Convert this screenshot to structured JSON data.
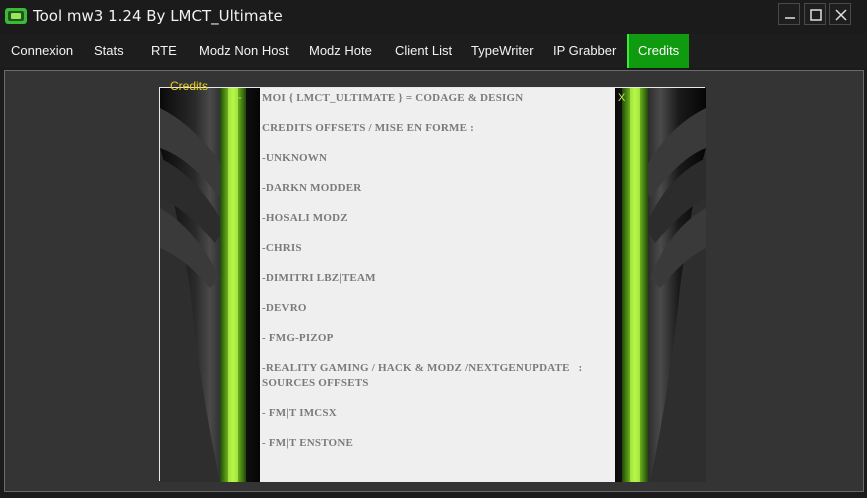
{
  "window": {
    "title": "Tool mw3 1.24 By LMCT_Ultimate",
    "icon": "app-logo-icon",
    "controls": [
      "minimize-icon",
      "maximize-icon",
      "close-icon"
    ]
  },
  "menu": {
    "tabs": [
      {
        "label": "Connexion",
        "active": false
      },
      {
        "label": "Stats",
        "active": false
      },
      {
        "label": "RTE",
        "active": false
      },
      {
        "label": "Modz Non Host",
        "active": false
      },
      {
        "label": "Modz Hote",
        "active": false
      },
      {
        "label": "Client List",
        "active": false
      },
      {
        "label": "TypeWriter",
        "active": false
      },
      {
        "label": "IP Grabber",
        "active": false
      },
      {
        "label": "Credits",
        "active": true
      }
    ]
  },
  "credits": {
    "group_label": "Credits",
    "art_controls": {
      "minimize": "-",
      "close": "X"
    },
    "lines": [
      "Moi { LMCT_Ultimate } = Codage & Design",
      "",
      "Credits Offsets / Mise en forme :",
      "",
      "-Unknown",
      "",
      "-DarkN Modder",
      "",
      "-Hosali Modz",
      "",
      "-Chris",
      "",
      "-Dimitri LBZ|Team",
      "",
      "-Devro",
      "",
      "- FMG-PiZop",
      "",
      "-Reality Gaming / Hack & Modz /NextGenUpdate   :",
      "Sources Offsets",
      "",
      "- FM|T iMCSx",
      "",
      "- FM|T Enstone"
    ]
  },
  "colors": {
    "accent_green": "#0f9a10",
    "legend_yellow": "#e8d21a",
    "background": "#1b1b1b",
    "panel": "#343434"
  }
}
